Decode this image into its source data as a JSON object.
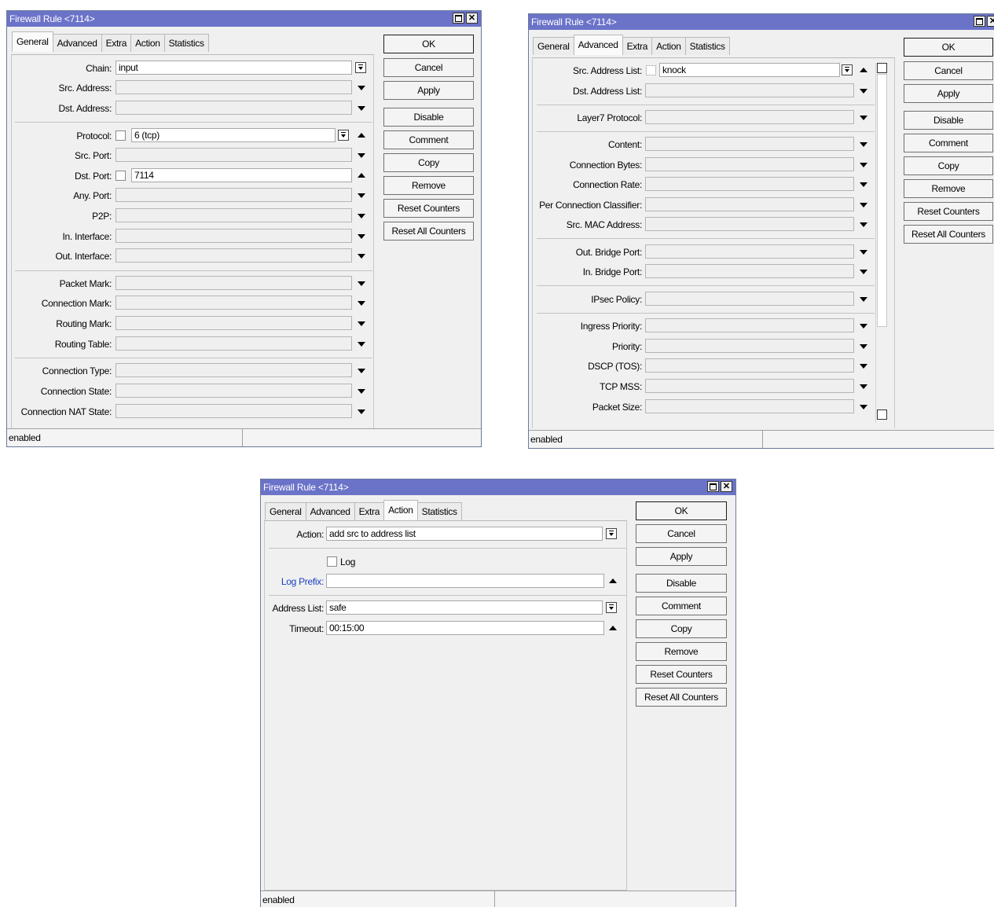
{
  "window_title": "Firewall Rule <7114>",
  "tabs": [
    "General",
    "Advanced",
    "Extra",
    "Action",
    "Statistics"
  ],
  "buttons": [
    "OK",
    "Cancel",
    "Apply",
    "Disable",
    "Comment",
    "Copy",
    "Remove",
    "Reset Counters",
    "Reset All Counters"
  ],
  "status_text": "enabled",
  "general": {
    "chain_label": "Chain:",
    "chain_value": "input",
    "src_address_label": "Src. Address:",
    "dst_address_label": "Dst. Address:",
    "protocol_label": "Protocol:",
    "protocol_value": "6 (tcp)",
    "src_port_label": "Src. Port:",
    "dst_port_label": "Dst. Port:",
    "dst_port_value": "7114",
    "any_port_label": "Any. Port:",
    "p2p_label": "P2P:",
    "in_interface_label": "In. Interface:",
    "out_interface_label": "Out. Interface:",
    "packet_mark_label": "Packet Mark:",
    "connection_mark_label": "Connection Mark:",
    "routing_mark_label": "Routing Mark:",
    "routing_table_label": "Routing Table:",
    "connection_type_label": "Connection Type:",
    "connection_state_label": "Connection State:",
    "connection_nat_state_label": "Connection NAT State:"
  },
  "advanced": {
    "src_address_list_label": "Src. Address List:",
    "src_address_list_value": "knock",
    "dst_address_list_label": "Dst. Address List:",
    "layer7_label": "Layer7 Protocol:",
    "content_label": "Content:",
    "connection_bytes_label": "Connection Bytes:",
    "connection_rate_label": "Connection Rate:",
    "pcc_label": "Per Connection Classifier:",
    "src_mac_label": "Src. MAC Address:",
    "out_bridge_port_label": "Out. Bridge Port:",
    "in_bridge_port_label": "In. Bridge Port:",
    "ipsec_policy_label": "IPsec Policy:",
    "ingress_priority_label": "Ingress Priority:",
    "priority_label": "Priority:",
    "dscp_label": "DSCP (TOS):",
    "tcp_mss_label": "TCP MSS:",
    "packet_size_label": "Packet Size:"
  },
  "action": {
    "action_label": "Action:",
    "action_value": "add src to address list",
    "log_label": "Log",
    "log_prefix_label": "Log Prefix:",
    "address_list_label": "Address List:",
    "address_list_value": "safe",
    "timeout_label": "Timeout:",
    "timeout_value": "00:15:00"
  }
}
